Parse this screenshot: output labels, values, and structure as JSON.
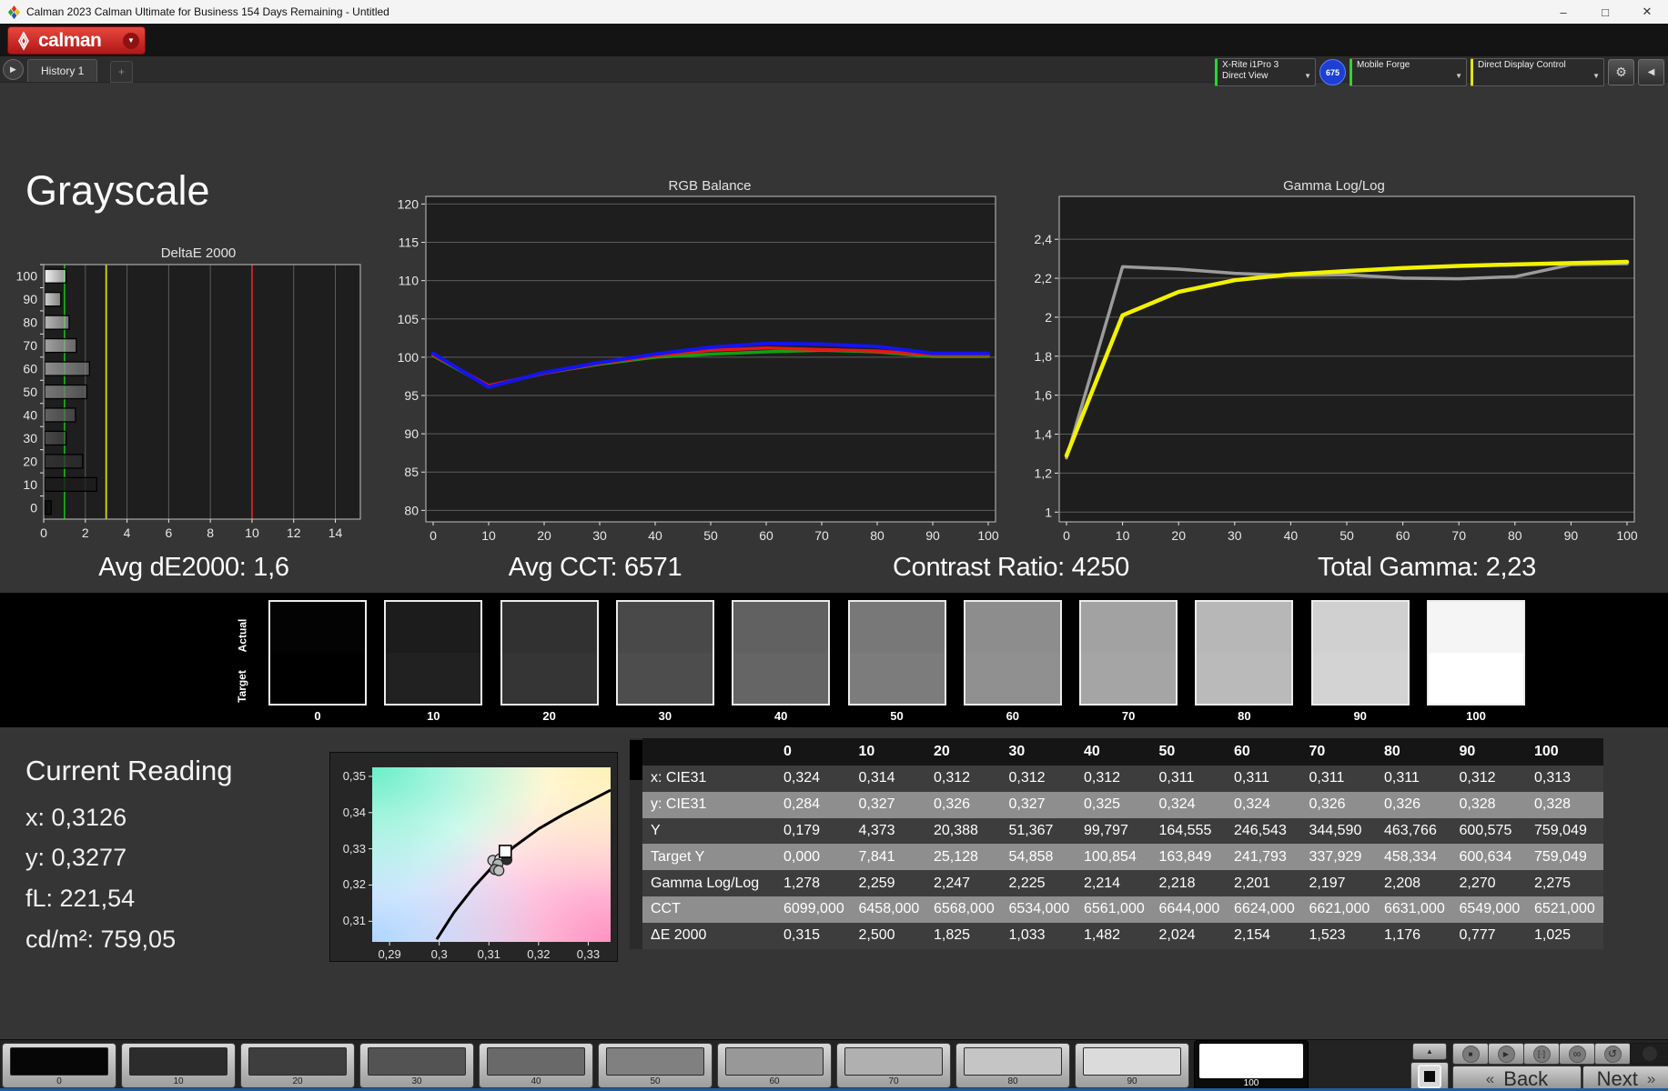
{
  "window": {
    "title": "Calman 2023 Calman Ultimate for Business 154 Days Remaining  - Untitled",
    "minimize_glyph": "–",
    "maximize_glyph": "□",
    "close_glyph": "✕"
  },
  "brand": {
    "logo_text": "calman",
    "accent_red": "#c42222"
  },
  "history": {
    "tab_label": "History 1",
    "add_label": "+",
    "scroll_glyph": "▶"
  },
  "meters": {
    "meter": {
      "line1": "X-Rite i1Pro 3",
      "line2": "Direct View",
      "stripe": "#2fd42f",
      "badge": "675",
      "badge_bg": "#1d3fd4"
    },
    "source": {
      "label": "Mobile Forge",
      "stripe": "#2fd42f"
    },
    "display": {
      "label": "Direct Display Control",
      "stripe": "#e3e316"
    },
    "settings_glyph": "⚙",
    "collapse_glyph": "◀"
  },
  "page_title": "Grayscale",
  "stats": [
    "Avg dE2000: 1,6",
    "Avg CCT: 6571",
    "Contrast Ratio: 4250",
    "Total Gamma: 2,23"
  ],
  "chart_data": [
    {
      "id": "deltae",
      "type": "bar",
      "orientation": "horizontal",
      "title": "DeltaE 2000",
      "categories": [
        "100",
        "90",
        "80",
        "70",
        "60",
        "50",
        "40",
        "30",
        "20",
        "10",
        "0"
      ],
      "values": [
        1.025,
        0.777,
        1.176,
        1.523,
        2.154,
        2.024,
        1.482,
        1.033,
        1.825,
        2.5,
        0.315
      ],
      "bar_colors": [
        "#f2f2f2",
        "#d0d0d0",
        "#b7b7b7",
        "#a2a2a2",
        "#8d8d8d",
        "#787878",
        "#616161",
        "#494949",
        "#313131",
        "#1c1c1c",
        "#0a0a0a"
      ],
      "xlim": [
        0,
        15.2
      ],
      "xticks": [
        0,
        2,
        4,
        6,
        8,
        10,
        12,
        14
      ],
      "ref_lines": [
        {
          "value": 1,
          "color": "#1fa51f"
        },
        {
          "value": 3,
          "color": "#d8d800"
        },
        {
          "value": 10,
          "color": "#d42222"
        }
      ],
      "grid": true
    },
    {
      "id": "rgb",
      "type": "line",
      "title": "RGB Balance",
      "x": [
        0,
        10,
        20,
        30,
        40,
        50,
        60,
        70,
        80,
        90,
        100
      ],
      "series": [
        {
          "name": "Green",
          "color": "#12a012",
          "values": [
            100.2,
            96.2,
            97.9,
            99.1,
            100.0,
            100.4,
            100.7,
            100.9,
            100.7,
            100.1,
            100.1
          ]
        },
        {
          "name": "Red",
          "color": "#e81616",
          "values": [
            100.3,
            96.3,
            97.9,
            99.2,
            100.2,
            100.9,
            101.2,
            101.0,
            100.8,
            100.3,
            100.3
          ]
        },
        {
          "name": "Blue",
          "color": "#1414f0",
          "values": [
            100.5,
            96.1,
            98.0,
            99.3,
            100.4,
            101.3,
            101.8,
            101.7,
            101.4,
            100.5,
            100.5
          ]
        }
      ],
      "ylim": [
        78.5,
        121
      ],
      "yticks": [
        {
          "v": 80,
          "l": "80"
        },
        {
          "v": 85,
          "l": "85"
        },
        {
          "v": 90,
          "l": "90"
        },
        {
          "v": 95,
          "l": "95"
        },
        {
          "v": 100,
          "l": "100"
        },
        {
          "v": 105,
          "l": "105"
        },
        {
          "v": 110,
          "l": "110"
        },
        {
          "v": 115,
          "l": "115"
        },
        {
          "v": 120,
          "l": "120"
        }
      ],
      "xticks": [
        0,
        10,
        20,
        30,
        40,
        50,
        60,
        70,
        80,
        90,
        100
      ],
      "grid": true
    },
    {
      "id": "gamma",
      "type": "line",
      "title": "Gamma Log/Log",
      "x": [
        0,
        10,
        20,
        30,
        40,
        50,
        60,
        70,
        80,
        90,
        100
      ],
      "series": [
        {
          "name": "Measured",
          "color": "#9b9b9b",
          "values": [
            1.278,
            2.259,
            2.247,
            2.225,
            2.214,
            2.218,
            2.201,
            2.197,
            2.208,
            2.27,
            2.275
          ]
        },
        {
          "name": "Target",
          "color": "#f2f200",
          "values": [
            1.29,
            2.01,
            2.13,
            2.19,
            2.22,
            2.237,
            2.252,
            2.263,
            2.271,
            2.278,
            2.284
          ]
        }
      ],
      "ylim": [
        0.95,
        2.62
      ],
      "yticks": [
        {
          "v": 1,
          "l": "1"
        },
        {
          "v": 1.2,
          "l": "1,2"
        },
        {
          "v": 1.4,
          "l": "1,4"
        },
        {
          "v": 1.6,
          "l": "1,6"
        },
        {
          "v": 1.8,
          "l": "1,8"
        },
        {
          "v": 2,
          "l": "2"
        },
        {
          "v": 2.2,
          "l": "2,2"
        },
        {
          "v": 2.4,
          "l": "2,4"
        }
      ],
      "xticks": [
        0,
        10,
        20,
        30,
        40,
        50,
        60,
        70,
        80,
        90,
        100
      ],
      "grid": true
    },
    {
      "id": "cie",
      "type": "scatter",
      "title": "CIE chromaticity detail",
      "xlim": [
        0.2865,
        0.3345
      ],
      "ylim": [
        0.3043,
        0.3525
      ],
      "xticks": [
        {
          "v": 0.29,
          "l": "0,29"
        },
        {
          "v": 0.3,
          "l": "0,3"
        },
        {
          "v": 0.31,
          "l": "0,31"
        },
        {
          "v": 0.32,
          "l": "0,32"
        },
        {
          "v": 0.33,
          "l": "0,33"
        }
      ],
      "yticks": [
        {
          "v": 0.31,
          "l": "0,31"
        },
        {
          "v": 0.32,
          "l": "0,32"
        },
        {
          "v": 0.33,
          "l": "0,33"
        },
        {
          "v": 0.34,
          "l": "0,34"
        },
        {
          "v": 0.35,
          "l": "0,35"
        }
      ],
      "locus": [
        [
          0.2995,
          0.305
        ],
        [
          0.303,
          0.3125
        ],
        [
          0.307,
          0.3195
        ],
        [
          0.311,
          0.3255
        ],
        [
          0.315,
          0.3305
        ],
        [
          0.32,
          0.3355
        ],
        [
          0.325,
          0.3395
        ],
        [
          0.33,
          0.343
        ],
        [
          0.3345,
          0.3462
        ]
      ],
      "points": [
        {
          "x": 0.3108,
          "y": 0.3268,
          "fill": "#c6c6c6"
        },
        {
          "x": 0.3122,
          "y": 0.3272,
          "fill": "#d6d6d6"
        },
        {
          "x": 0.3118,
          "y": 0.3258,
          "fill": "#b4b4b4"
        },
        {
          "x": 0.3112,
          "y": 0.3243,
          "fill": "#9a9a9a"
        },
        {
          "x": 0.312,
          "y": 0.324,
          "fill": "#c0c0c0"
        },
        {
          "x": 0.3136,
          "y": 0.327,
          "fill": "#2e2e2e"
        }
      ],
      "target_marker": {
        "x": 0.3133,
        "y": 0.3293
      }
    }
  ],
  "swatches": {
    "actual_label": "Actual",
    "target_label": "Target",
    "labels": [
      "0",
      "10",
      "20",
      "30",
      "40",
      "50",
      "60",
      "70",
      "80",
      "90",
      "100"
    ],
    "actual_colors": [
      "#030303",
      "#1c1c1c",
      "#313131",
      "#494949",
      "#616161",
      "#787878",
      "#8d8d8d",
      "#a2a2a2",
      "#b7b7b7",
      "#d0d0d0",
      "#f5f5f5"
    ],
    "target_colors": [
      "#000000",
      "#212121",
      "#353535",
      "#4d4d4d",
      "#656565",
      "#7c7c7c",
      "#909090",
      "#a5a5a5",
      "#bababa",
      "#d3d3d3",
      "#ffffff"
    ]
  },
  "current_reading": {
    "title": "Current Reading",
    "lines": [
      "x: 0,3126",
      "y: 0,3277",
      "fL: 221,54",
      "cd/m²: 759,05"
    ]
  },
  "table": {
    "columns": [
      "0",
      "10",
      "20",
      "30",
      "40",
      "50",
      "60",
      "70",
      "80",
      "90",
      "100"
    ],
    "rows": [
      {
        "label": "x: CIE31",
        "shade": "dark",
        "values": [
          "0,324",
          "0,314",
          "0,312",
          "0,312",
          "0,312",
          "0,311",
          "0,311",
          "0,311",
          "0,311",
          "0,312",
          "0,313"
        ]
      },
      {
        "label": "y: CIE31",
        "shade": "light",
        "values": [
          "0,284",
          "0,327",
          "0,326",
          "0,327",
          "0,325",
          "0,324",
          "0,324",
          "0,326",
          "0,326",
          "0,328",
          "0,328"
        ]
      },
      {
        "label": "Y",
        "shade": "dark",
        "values": [
          "0,179",
          "4,373",
          "20,388",
          "51,367",
          "99,797",
          "164,555",
          "246,543",
          "344,590",
          "463,766",
          "600,575",
          "759,049"
        ]
      },
      {
        "label": "Target Y",
        "shade": "light",
        "values": [
          "0,000",
          "7,841",
          "25,128",
          "54,858",
          "100,854",
          "163,849",
          "241,793",
          "337,929",
          "458,334",
          "600,634",
          "759,049"
        ]
      },
      {
        "label": "Gamma Log/Log",
        "shade": "dark",
        "values": [
          "1,278",
          "2,259",
          "2,247",
          "2,225",
          "2,214",
          "2,218",
          "2,201",
          "2,197",
          "2,208",
          "2,270",
          "2,275"
        ]
      },
      {
        "label": "CCT",
        "shade": "light",
        "values": [
          "6099,000",
          "6458,000",
          "6568,000",
          "6534,000",
          "6561,000",
          "6644,000",
          "6624,000",
          "6621,000",
          "6631,000",
          "6549,000",
          "6521,000"
        ]
      },
      {
        "label": "ΔE 2000",
        "shade": "dark",
        "values": [
          "0,315",
          "2,500",
          "1,825",
          "1,033",
          "1,482",
          "2,024",
          "2,154",
          "1,523",
          "1,176",
          "0,777",
          "1,025"
        ]
      }
    ]
  },
  "bottom": {
    "patches": [
      {
        "label": "0",
        "color": "#060606"
      },
      {
        "label": "10",
        "color": "#2c2c2c"
      },
      {
        "label": "20",
        "color": "#3e3e3e"
      },
      {
        "label": "30",
        "color": "#535353"
      },
      {
        "label": "40",
        "color": "#696969"
      },
      {
        "label": "50",
        "color": "#808080"
      },
      {
        "label": "60",
        "color": "#989898"
      },
      {
        "label": "70",
        "color": "#b0b0b0"
      },
      {
        "label": "80",
        "color": "#c5c5c5"
      },
      {
        "label": "90",
        "color": "#dbdbdb"
      },
      {
        "label": "100",
        "color": "#ffffff",
        "selected": true
      }
    ],
    "transport": [
      {
        "name": "stop-button",
        "glyph": "■"
      },
      {
        "name": "play-button",
        "glyph": "▶"
      },
      {
        "name": "measure-window-button",
        "glyph": "[·]"
      },
      {
        "name": "continuous-measure-button",
        "glyph": "∞"
      },
      {
        "name": "refresh-button",
        "glyph": "↺"
      }
    ],
    "up_glyph": "▲",
    "back_label": "Back",
    "next_label": "Next",
    "back_chevron": "«",
    "next_chevron": "»"
  }
}
